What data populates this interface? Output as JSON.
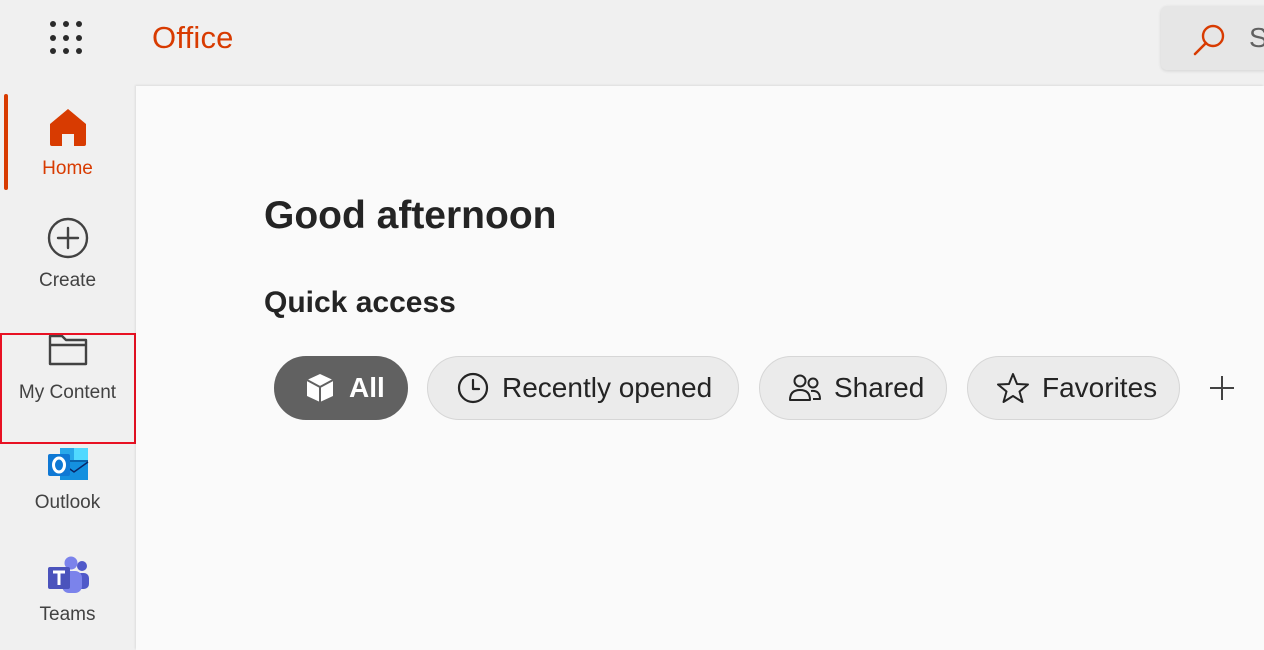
{
  "header": {
    "app_launcher_icon": "waffle-icon",
    "brand": "Office",
    "search_placeholder": "S",
    "search_icon": "search-icon"
  },
  "rail": {
    "items": [
      {
        "label": "Home",
        "icon": "home-icon",
        "active": true
      },
      {
        "label": "Create",
        "icon": "add-circle-icon"
      },
      {
        "label": "My Content",
        "icon": "folder-icon"
      },
      {
        "label": "Outlook",
        "icon": "outlook-icon"
      },
      {
        "label": "Teams",
        "icon": "teams-icon"
      }
    ]
  },
  "main": {
    "greeting": "Good afternoon",
    "quick_access_title": "Quick access",
    "filters": [
      {
        "label": "All",
        "icon": "cube-icon",
        "selected": true
      },
      {
        "label": "Recently opened",
        "icon": "clock-icon"
      },
      {
        "label": "Shared",
        "icon": "people-icon"
      },
      {
        "label": "Favorites",
        "icon": "star-icon"
      }
    ],
    "add_icon": "plus-icon"
  },
  "colors": {
    "accent": "#d83b01",
    "highlight_border": "#e81123",
    "selected_pill": "#616161"
  }
}
